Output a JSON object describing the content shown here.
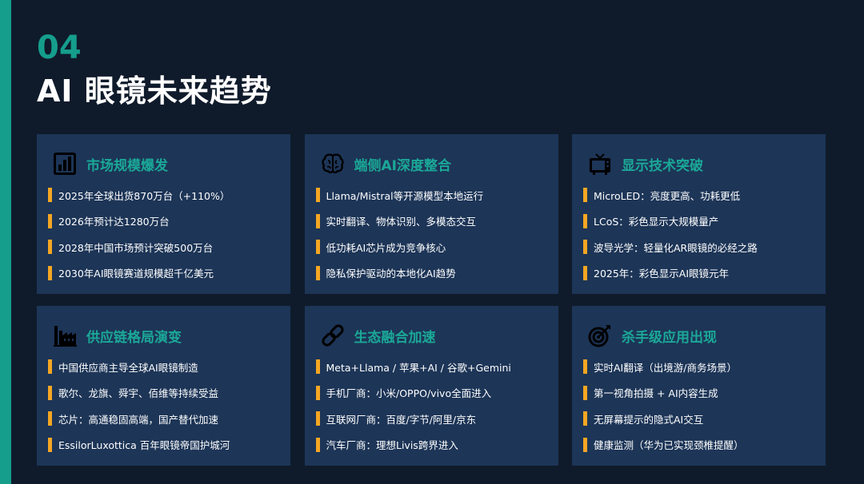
{
  "header": {
    "section_number": "04",
    "title": "AI 眼镜未来趋势"
  },
  "colors": {
    "background": "#0f1b2b",
    "card": "#1d3557",
    "accent_teal": "#159e8c",
    "bullet_orange": "#f5a623"
  },
  "cards": [
    {
      "icon": "bar-chart-icon",
      "title": "市场规模爆发",
      "items": [
        "2025年全球出货870万台（+110%）",
        "2026年预计达1280万台",
        "2028年中国市场预计突破500万台",
        "2030年AI眼镜赛道规模超千亿美元"
      ]
    },
    {
      "icon": "brain-icon",
      "title": "端侧AI深度整合",
      "items": [
        "Llama/Mistral等开源模型本地运行",
        "实时翻译、物体识别、多模态交互",
        "低功耗AI芯片成为竞争核心",
        "隐私保护驱动的本地化AI趋势"
      ]
    },
    {
      "icon": "tv-icon",
      "title": "显示技术突破",
      "items": [
        "MicroLED：亮度更高、功耗更低",
        "LCoS：彩色显示大规模量产",
        "波导光学：轻量化AR眼镜的必经之路",
        "2025年：彩色显示AI眼镜元年"
      ]
    },
    {
      "icon": "factory-icon",
      "title": "供应链格局演变",
      "items": [
        "中国供应商主导全球AI眼镜制造",
        "歌尔、龙旗、舜宇、佰维等持续受益",
        "芯片：高通稳固高端，国产替代加速",
        "EssilorLuxottica 百年眼镜帝国护城河"
      ]
    },
    {
      "icon": "link-icon",
      "title": "生态融合加速",
      "items": [
        "Meta+Llama / 苹果+AI / 谷歌+Gemini",
        "手机厂商：小米/OPPO/vivo全面进入",
        "互联网厂商：百度/字节/阿里/京东",
        "汽车厂商：理想Livis跨界进入"
      ]
    },
    {
      "icon": "target-icon",
      "title": "杀手级应用出现",
      "items": [
        "实时AI翻译（出境游/商务场景）",
        "第一视角拍摄 + AI内容生成",
        "无屏幕提示的隐式AI交互",
        "健康监测（华为已实现颈椎提醒）"
      ]
    }
  ]
}
